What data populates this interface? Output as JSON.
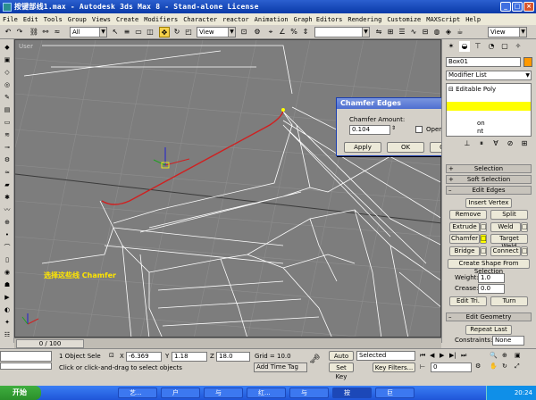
{
  "title": "按键部线1.max - Autodesk 3ds Max 8 - Stand-alone License",
  "menu": [
    "File",
    "Edit",
    "Tools",
    "Group",
    "Views",
    "Create",
    "Modifiers",
    "Character",
    "reactor",
    "Animation",
    "Graph Editors",
    "Rendering",
    "Customize",
    "MAXScript",
    "Help"
  ],
  "toolbar": {
    "filter": "All",
    "refcoord": "View",
    "refcoord2": "View"
  },
  "viewport": {
    "label": "User",
    "caption": "选择这些线  Chamfer"
  },
  "dialog": {
    "title": "Chamfer Edges",
    "amount_label": "Chamfer Amount:",
    "amount_value": "0.104",
    "open_label": "Open",
    "apply": "Apply",
    "ok": "OK",
    "cancel": "Cancel"
  },
  "panel": {
    "object_name": "Box01",
    "modifier_list": "Modifier List",
    "stack_item": "Editable Poly",
    "stack_sub1": "on",
    "stack_sub2": "nt",
    "rollouts": {
      "selection": "Selection",
      "soft_selection": "Soft Selection",
      "edit_edges": "Edit Edges",
      "edit_geometry": "Edit Geometry"
    },
    "buttons": {
      "insert_vertex": "Insert Vertex",
      "remove": "Remove",
      "split": "Split",
      "extrude": "Extrude",
      "weld": "Weld",
      "chamfer": "Chamfer",
      "target_weld": "Target Weld",
      "bridge": "Bridge",
      "connect": "Connect",
      "create_shape": "Create Shape From Selection",
      "edit_tri": "Edit Tri.",
      "turn": "Turn",
      "repeat_last": "Repeat Last"
    },
    "weight_label": "Weight:",
    "weight_value": "1.0",
    "crease_label": "Crease:",
    "crease_value": "0.0",
    "constraints_label": "Constraints:",
    "constraints_value": "None"
  },
  "timeline": {
    "slider": "0 / 100"
  },
  "status": {
    "selected_count": "1 Object Sele",
    "x_label": "X",
    "x_value": "-6.369",
    "y_label": "Y",
    "y_value": "1.18",
    "z_label": "Z",
    "z_value": "18.0",
    "grid": "Grid = 10.0",
    "auto_key": "Auto Key",
    "set_key": "Set Key",
    "key_mode": "Selected",
    "key_filters": "Key Filters...",
    "frame": "0",
    "prompt": "Click or click-and-drag to select objects",
    "add_time_tag": "Add Time Tag"
  },
  "taskbar": {
    "start": "开始",
    "tasks": [
      "艺...",
      "户",
      "与",
      "红...",
      "与",
      "按",
      "巨"
    ],
    "clock": "20:24"
  },
  "colors": {
    "title_blue": "#0a3aa8",
    "viewport_gray": "#7d7d7d",
    "selected_edge": "#d02020",
    "selection_yellow": "#ffff00",
    "caption_yellow": "#ffe600"
  }
}
